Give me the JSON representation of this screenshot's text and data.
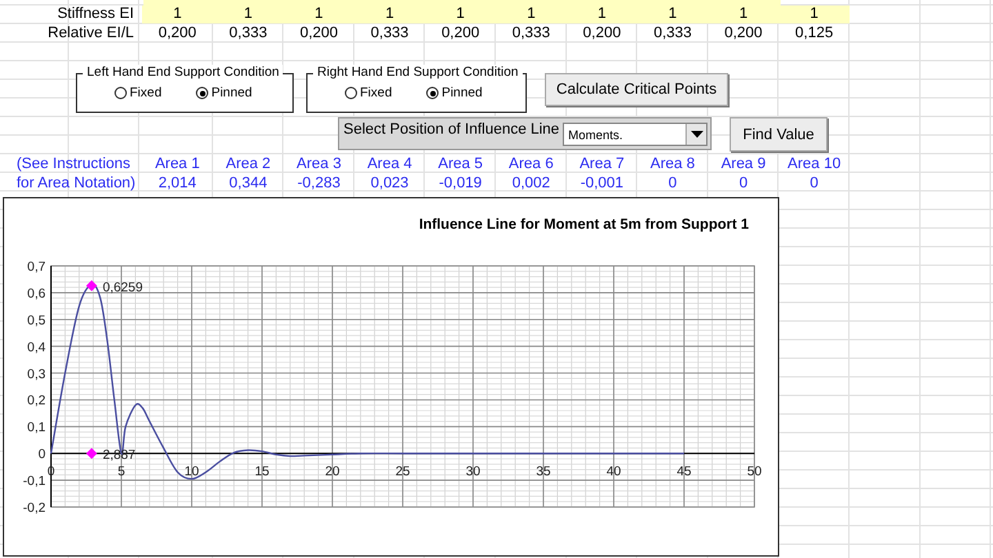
{
  "sheet": {
    "rows": [
      {
        "label": "Stiffness EI",
        "kind": "input",
        "cells": [
          "1",
          "1",
          "1",
          "1",
          "1",
          "1",
          "1",
          "1",
          "1",
          "1"
        ]
      },
      {
        "label": "Relative EI/L",
        "kind": "computed",
        "cells": [
          "0,200",
          "0,333",
          "0,200",
          "0,333",
          "0,200",
          "0,333",
          "0,200",
          "0,333",
          "0,200",
          "0,125"
        ]
      }
    ]
  },
  "left_support": {
    "title": "Left Hand End Support Condition",
    "options": [
      {
        "label": "Fixed",
        "selected": false
      },
      {
        "label": "Pinned",
        "selected": true
      }
    ]
  },
  "right_support": {
    "title": "Right Hand End Support Condition",
    "options": [
      {
        "label": "Fixed",
        "selected": false
      },
      {
        "label": "Pinned",
        "selected": true
      }
    ]
  },
  "calculate_button": "Calculate Critical Points",
  "position_selector": {
    "label": "Select Position of Influence Line",
    "value": "Moments."
  },
  "find_button": "Find Value",
  "areas": {
    "note": [
      "(See Instructions",
      "for Area Notation)"
    ],
    "headers": [
      "Area 1",
      "Area 2",
      "Area 3",
      "Area 4",
      "Area 5",
      "Area 6",
      "Area 7",
      "Area 8",
      "Area 9",
      "Area 10"
    ],
    "values": [
      "2,014",
      "0,344",
      "-0,283",
      "0,023",
      "-0,019",
      "0,002",
      "-0,001",
      "0",
      "0",
      "0"
    ]
  },
  "chart": {
    "chart_data": {
      "type": "line",
      "title": "Influence Line for Moment at 5m from Support 1",
      "x": [
        0,
        1,
        2,
        2.887,
        3.5,
        4,
        4.5,
        5,
        5.3,
        6,
        6.5,
        7,
        8,
        9,
        10,
        11,
        12,
        13,
        14,
        15,
        16,
        17,
        18,
        20,
        22,
        25,
        30,
        35,
        40,
        45
      ],
      "series": [
        {
          "color": "#4a4ea0",
          "values": [
            0,
            0.3,
            0.55,
            0.63,
            0.58,
            0.42,
            0.2,
            0,
            0.1,
            0.18,
            0.17,
            0.12,
            0.02,
            -0.07,
            -0.095,
            -0.07,
            -0.03,
            0.003,
            0.012,
            0.008,
            -0.004,
            -0.01,
            -0.008,
            -0.004,
            0,
            0,
            0,
            0,
            0,
            0
          ]
        }
      ],
      "grid": true,
      "xlim": [
        0,
        50
      ],
      "ylim": [
        -0.2,
        0.7
      ],
      "xticks": [
        0,
        5,
        10,
        15,
        20,
        25,
        30,
        35,
        40,
        45,
        50
      ],
      "yticks": [
        {
          "value": 0.7,
          "label": "0,7"
        },
        {
          "value": 0.6,
          "label": "0,6"
        },
        {
          "value": 0.5,
          "label": "0,5"
        },
        {
          "value": 0.4,
          "label": "0,4"
        },
        {
          "value": 0.3,
          "label": "0,3"
        },
        {
          "value": 0.2,
          "label": "0,2"
        },
        {
          "value": 0.1,
          "label": "0,1"
        },
        {
          "value": 0,
          "label": "0"
        },
        {
          "value": -0.1,
          "label": "-0,1"
        },
        {
          "value": -0.2,
          "label": "-0,2"
        }
      ],
      "annotations": [
        {
          "x": 2.887,
          "y": 0.6259,
          "text": "0,6259"
        },
        {
          "x": 2.887,
          "y": 0,
          "text": "2,887"
        }
      ]
    }
  }
}
